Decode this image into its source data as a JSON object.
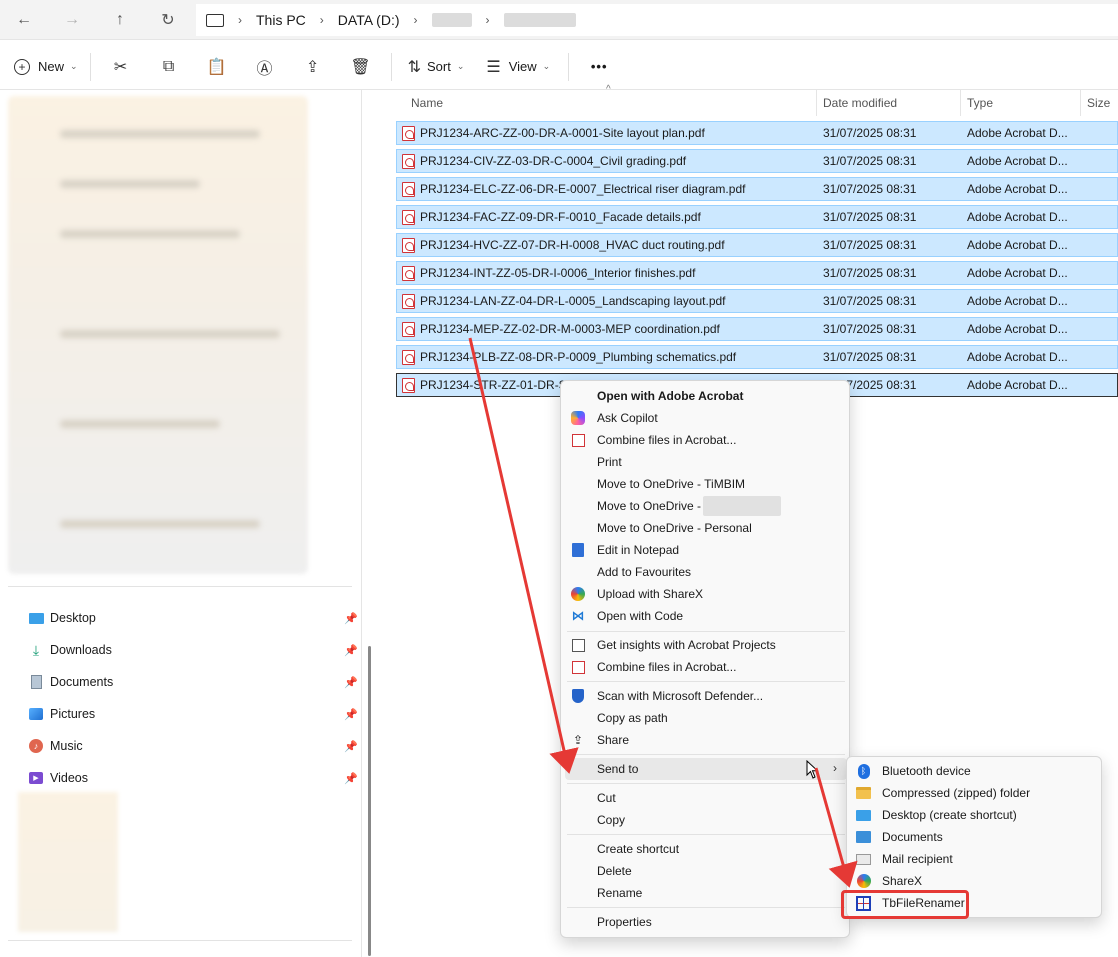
{
  "address": {
    "back_icon": "←",
    "forward_icon": "→",
    "up_icon": "↑",
    "refresh_icon": "↻",
    "pc_icon": "🖥",
    "crumbs": [
      "This PC",
      "DATA (D:)"
    ]
  },
  "toolbar": {
    "new_label": "New",
    "sort_label": "Sort",
    "view_label": "View",
    "more_label": "•••"
  },
  "quick_access": [
    {
      "label": "Desktop",
      "icon": "desktop-icon"
    },
    {
      "label": "Downloads",
      "icon": "download-icon"
    },
    {
      "label": "Documents",
      "icon": "document-icon"
    },
    {
      "label": "Pictures",
      "icon": "picture-icon"
    },
    {
      "label": "Music",
      "icon": "music-icon"
    },
    {
      "label": "Videos",
      "icon": "video-icon"
    }
  ],
  "columns": {
    "name": "Name",
    "date": "Date modified",
    "type": "Type",
    "size": "Size"
  },
  "files": [
    {
      "name": "PRJ1234-ARC-ZZ-00-DR-A-0001-Site layout plan.pdf",
      "date": "31/07/2025 08:31",
      "type": "Adobe Acrobat D..."
    },
    {
      "name": "PRJ1234-CIV-ZZ-03-DR-C-0004_Civil grading.pdf",
      "date": "31/07/2025 08:31",
      "type": "Adobe Acrobat D..."
    },
    {
      "name": "PRJ1234-ELC-ZZ-06-DR-E-0007_Electrical riser diagram.pdf",
      "date": "31/07/2025 08:31",
      "type": "Adobe Acrobat D..."
    },
    {
      "name": "PRJ1234-FAC-ZZ-09-DR-F-0010_Facade details.pdf",
      "date": "31/07/2025 08:31",
      "type": "Adobe Acrobat D..."
    },
    {
      "name": "PRJ1234-HVC-ZZ-07-DR-H-0008_HVAC duct routing.pdf",
      "date": "31/07/2025 08:31",
      "type": "Adobe Acrobat D..."
    },
    {
      "name": "PRJ1234-INT-ZZ-05-DR-I-0006_Interior finishes.pdf",
      "date": "31/07/2025 08:31",
      "type": "Adobe Acrobat D..."
    },
    {
      "name": "PRJ1234-LAN-ZZ-04-DR-L-0005_Landscaping layout.pdf",
      "date": "31/07/2025 08:31",
      "type": "Adobe Acrobat D..."
    },
    {
      "name": "PRJ1234-MEP-ZZ-02-DR-M-0003-MEP coordination.pdf",
      "date": "31/07/2025 08:31",
      "type": "Adobe Acrobat D..."
    },
    {
      "name": "PRJ1234-PLB-ZZ-08-DR-P-0009_Plumbing schematics.pdf",
      "date": "31/07/2025 08:31",
      "type": "Adobe Acrobat D..."
    },
    {
      "name": "PRJ1234-STR-ZZ-01-DR-S-",
      "date": "31/07/2025 08:31",
      "type": "Adobe Acrobat D..."
    }
  ],
  "context_menu": {
    "open_acrobat": "Open with Adobe Acrobat",
    "ask_copilot": "Ask Copilot",
    "combine_acrobat_1": "Combine files in Acrobat...",
    "print": "Print",
    "move_onedrive_timbim": "Move to OneDrive - TiMBIM",
    "move_onedrive_hidden": "Move to OneDrive -",
    "move_onedrive_personal": "Move to OneDrive - Personal",
    "edit_notepad": "Edit in Notepad",
    "add_favourites": "Add to Favourites",
    "upload_sharex": "Upload with ShareX",
    "open_code": "Open with Code",
    "insights_acrobat": "Get insights with Acrobat Projects",
    "combine_acrobat_2": "Combine files in Acrobat...",
    "scan_defender": "Scan with Microsoft Defender...",
    "copy_path": "Copy as path",
    "share": "Share",
    "send_to": "Send to",
    "cut": "Cut",
    "copy": "Copy",
    "create_shortcut": "Create shortcut",
    "delete": "Delete",
    "rename": "Rename",
    "properties": "Properties"
  },
  "send_to": [
    {
      "label": "Bluetooth device",
      "icon": "bluetooth-icon"
    },
    {
      "label": "Compressed (zipped) folder",
      "icon": "zip-folder-icon"
    },
    {
      "label": "Desktop (create shortcut)",
      "icon": "desktop-icon"
    },
    {
      "label": "Documents",
      "icon": "documents-icon"
    },
    {
      "label": "Mail recipient",
      "icon": "mail-icon"
    },
    {
      "label": "ShareX",
      "icon": "sharex-icon"
    },
    {
      "label": "TbFileRenamer",
      "icon": "tbfilerenamer-icon"
    }
  ],
  "colors": {
    "selection": "#cce8ff",
    "selection_border": "#99d1ff",
    "annotation": "#e53935"
  }
}
